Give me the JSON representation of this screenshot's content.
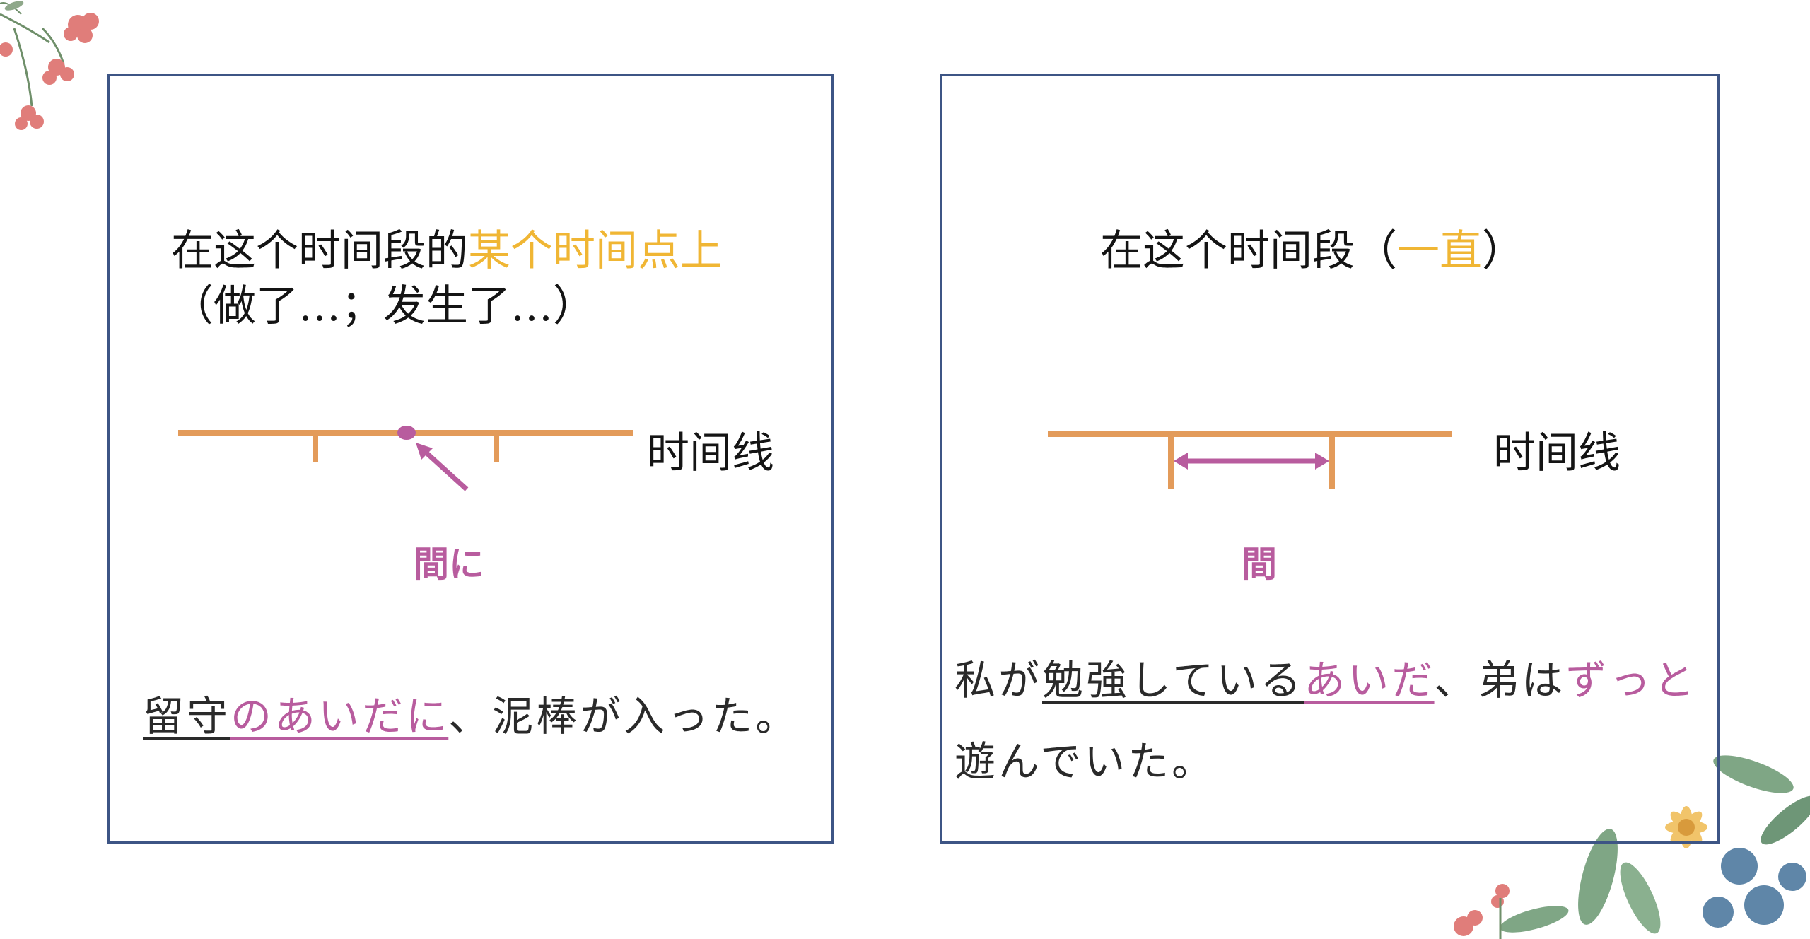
{
  "left_panel": {
    "heading_line1_prefix": "在这个时间段的",
    "heading_line1_highlight": "某个时间点上",
    "heading_line2": "（做了…；发生了…）",
    "timeline_label": "时间线",
    "marker_label": "間に",
    "sentence": {
      "part1": "留守",
      "part2": "のあいだに",
      "part3": "、泥棒が入った。"
    }
  },
  "right_panel": {
    "heading_prefix": "在这个时间段（",
    "heading_highlight": "一直",
    "heading_suffix": "）",
    "timeline_label": "时间线",
    "marker_label": "間",
    "sentence_line1": {
      "part1": "私が",
      "part2": "勉強している",
      "part3": "あいだ",
      "part4": "、弟は",
      "part5": "ずっと"
    },
    "sentence_line2": "遊んでいた。"
  },
  "colors": {
    "timeline": "#e39b5a",
    "marker": "#b85c9e",
    "highlight": "#f0b634",
    "frame": "#3d5585"
  }
}
